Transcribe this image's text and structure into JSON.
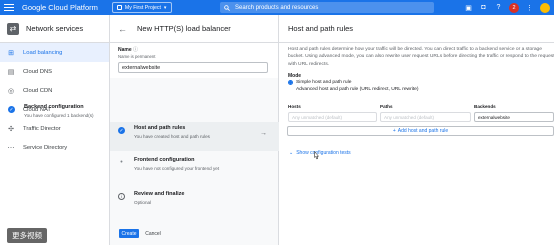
{
  "topbar": {
    "title": "Google Cloud Platform",
    "project": "My First Project",
    "search_placeholder": "Search products and resources",
    "notification_count": "2"
  },
  "leftnav": {
    "title": "Network services",
    "items": [
      {
        "label": "Load balancing",
        "icon": "load-balancer-icon",
        "active": true
      },
      {
        "label": "Cloud DNS",
        "icon": "dns-icon",
        "active": false
      },
      {
        "label": "Cloud CDN",
        "icon": "cdn-icon",
        "active": false
      },
      {
        "label": "Cloud NAT",
        "icon": "nat-icon",
        "active": false
      },
      {
        "label": "Traffic Director",
        "icon": "traffic-director-icon",
        "active": false
      },
      {
        "label": "Service Directory",
        "icon": "service-directory-icon",
        "active": false
      }
    ]
  },
  "watermark": "更多视频",
  "middle": {
    "title": "New HTTP(S) load balancer",
    "name_label": "Name",
    "name_hint": "Name is permanent",
    "name_value": "externalwebsite",
    "steps": [
      {
        "title": "Backend configuration",
        "subtitle": "You have configured 1 backend(s)",
        "status": "done"
      },
      {
        "title": "Host and path rules",
        "subtitle": "You have created host and path rules",
        "status": "done"
      },
      {
        "title": "Frontend configuration",
        "subtitle": "You have not configured your frontend yet",
        "status": "pending"
      },
      {
        "title": "Review and finalize",
        "subtitle": "Optional",
        "status": "info"
      }
    ],
    "create_label": "Create",
    "cancel_label": "Cancel"
  },
  "right": {
    "title": "Host and path rules",
    "description": "Host and path rules determine how your traffic will be directed. You can direct traffic to a backend service or a storage bucket. Using advanced mode, you can also rewrite user request URLs before directing the traffic or respond to the request with URL redirects.",
    "mode_label": "Mode",
    "mode_options": [
      {
        "label": "Simple host and path rule",
        "selected": true
      },
      {
        "label": "Advanced host and path rule (URL redirect, URL rewrite)",
        "selected": false
      }
    ],
    "columns": {
      "hosts": "Hosts",
      "paths": "Paths",
      "backends": "Backends"
    },
    "row": {
      "hosts": "Any unmatched (default)",
      "paths": "Any unmatched (default)",
      "backends": "externalwebsite"
    },
    "add_rule_label": "Add host and path rule",
    "show_tests_label": "Show configuration tests"
  },
  "colors": {
    "accent": "#1a73e8",
    "active_nav_bg": "#e8f0fe",
    "badge": "#d93025"
  }
}
